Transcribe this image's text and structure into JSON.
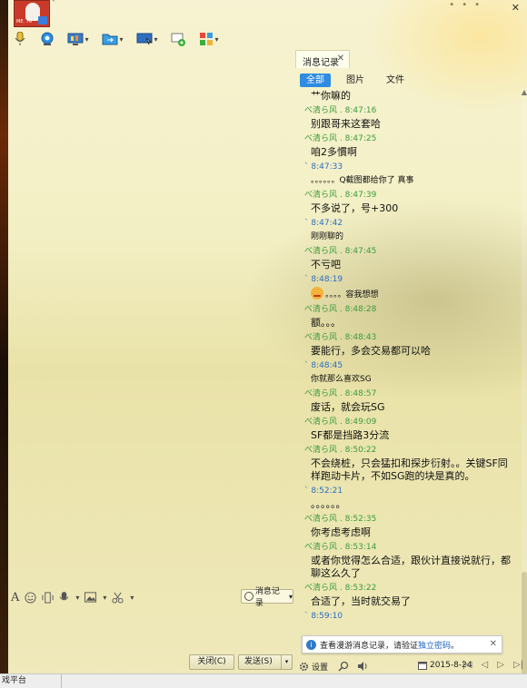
{
  "window": {
    "title_mark": "`",
    "close_symbol": "✕"
  },
  "avatar": {
    "tag": "ME. 76"
  },
  "toolbar": {
    "icons": [
      "microphone-icon",
      "webcam-icon",
      "screen-share-icon",
      "file-transfer-icon",
      "remote-desktop-icon",
      "new-chat-icon",
      "apps-icon"
    ]
  },
  "history_panel": {
    "tab_label": "消息记录",
    "tab_close": "✕",
    "filters": [
      "全部",
      "图片",
      "文件"
    ],
    "active_filter": "全部",
    "messages": [
      {
        "type": "text",
        "text": "艹你嘛的"
      },
      {
        "type": "meta",
        "sender": "べ清ら风 .",
        "time": "8:47:16"
      },
      {
        "type": "text",
        "text": "别跟哥来这套哈"
      },
      {
        "type": "meta",
        "sender": "べ清ら风 .",
        "time": "8:47:25"
      },
      {
        "type": "text",
        "text": "咱2多慣啊"
      },
      {
        "type": "meta-self",
        "sender": "`",
        "time": "8:47:33"
      },
      {
        "type": "text",
        "text": "。。。。。。Q截图都给你了  真事",
        "small": true
      },
      {
        "type": "meta",
        "sender": "べ清ら风 .",
        "time": "8:47:39"
      },
      {
        "type": "text",
        "text": "不多说了，号+300"
      },
      {
        "type": "meta-self",
        "sender": "`",
        "time": "8:47:42"
      },
      {
        "type": "text",
        "text": "刚刚聊的",
        "small": true
      },
      {
        "type": "meta",
        "sender": "べ清ら风 .",
        "time": "8:47:45"
      },
      {
        "type": "text",
        "text": "不亏吧"
      },
      {
        "type": "meta-self",
        "sender": "`",
        "time": "8:48:19"
      },
      {
        "type": "text",
        "text": "。。。。容我想想",
        "small": true,
        "emoji": true
      },
      {
        "type": "meta",
        "sender": "べ清ら风 .",
        "time": "8:48:28"
      },
      {
        "type": "text",
        "text": "额。。。"
      },
      {
        "type": "meta",
        "sender": "べ清ら风 .",
        "time": "8:48:43"
      },
      {
        "type": "text",
        "text": "要能行，多会交易都可以哈"
      },
      {
        "type": "meta-self",
        "sender": "`",
        "time": "8:48:45"
      },
      {
        "type": "text",
        "text": "你就那么喜欢SG",
        "small": true
      },
      {
        "type": "meta",
        "sender": "べ清ら风 .",
        "time": "8:48:57"
      },
      {
        "type": "text",
        "text": "废话，就会玩SG"
      },
      {
        "type": "meta",
        "sender": "べ清ら风 .",
        "time": "8:49:09"
      },
      {
        "type": "text",
        "text": "SF都是挡路3分流"
      },
      {
        "type": "meta",
        "sender": "べ清ら风 .",
        "time": "8:50:22"
      },
      {
        "type": "text",
        "text": "不会绕桩，只会猛扣和探步衍射。。关键SF同样跑动卡片，不如SG跑的块是真的。"
      },
      {
        "type": "meta-self",
        "sender": "`",
        "time": "8:52:21"
      },
      {
        "type": "text",
        "text": "。。。。。。"
      },
      {
        "type": "meta",
        "sender": "べ清ら风 .",
        "time": "8:52:35"
      },
      {
        "type": "text",
        "text": "你考虑考虑啊"
      },
      {
        "type": "meta",
        "sender": "べ清ら风 .",
        "time": "8:53:14"
      },
      {
        "type": "text",
        "text": "或者你觉得怎么合适，跟伙计直接说就行，都聊这么久了"
      },
      {
        "type": "meta",
        "sender": "べ清ら风 .",
        "time": "8:53:22"
      },
      {
        "type": "text",
        "text": "合适了，当时就交易了"
      },
      {
        "type": "meta-self",
        "sender": "`",
        "time": "8:59:10"
      }
    ]
  },
  "notice": {
    "info_symbol": "i",
    "text": "查看漫游消息记录，请验证",
    "link": "独立密码",
    "suffix": "。",
    "close": "✕"
  },
  "panel_bottom": {
    "settings_label": "设置",
    "date": "2015-8-24",
    "nav": [
      "|◁",
      "◁",
      "▷",
      "▷|"
    ]
  },
  "input_bar": {
    "history_button": "消息记录",
    "history_caret": "▾"
  },
  "actions": {
    "close_label": "关闭(C)",
    "send_label": "发送(S)",
    "send_caret": "▾"
  },
  "statusbar": {
    "text": "戏平台"
  }
}
